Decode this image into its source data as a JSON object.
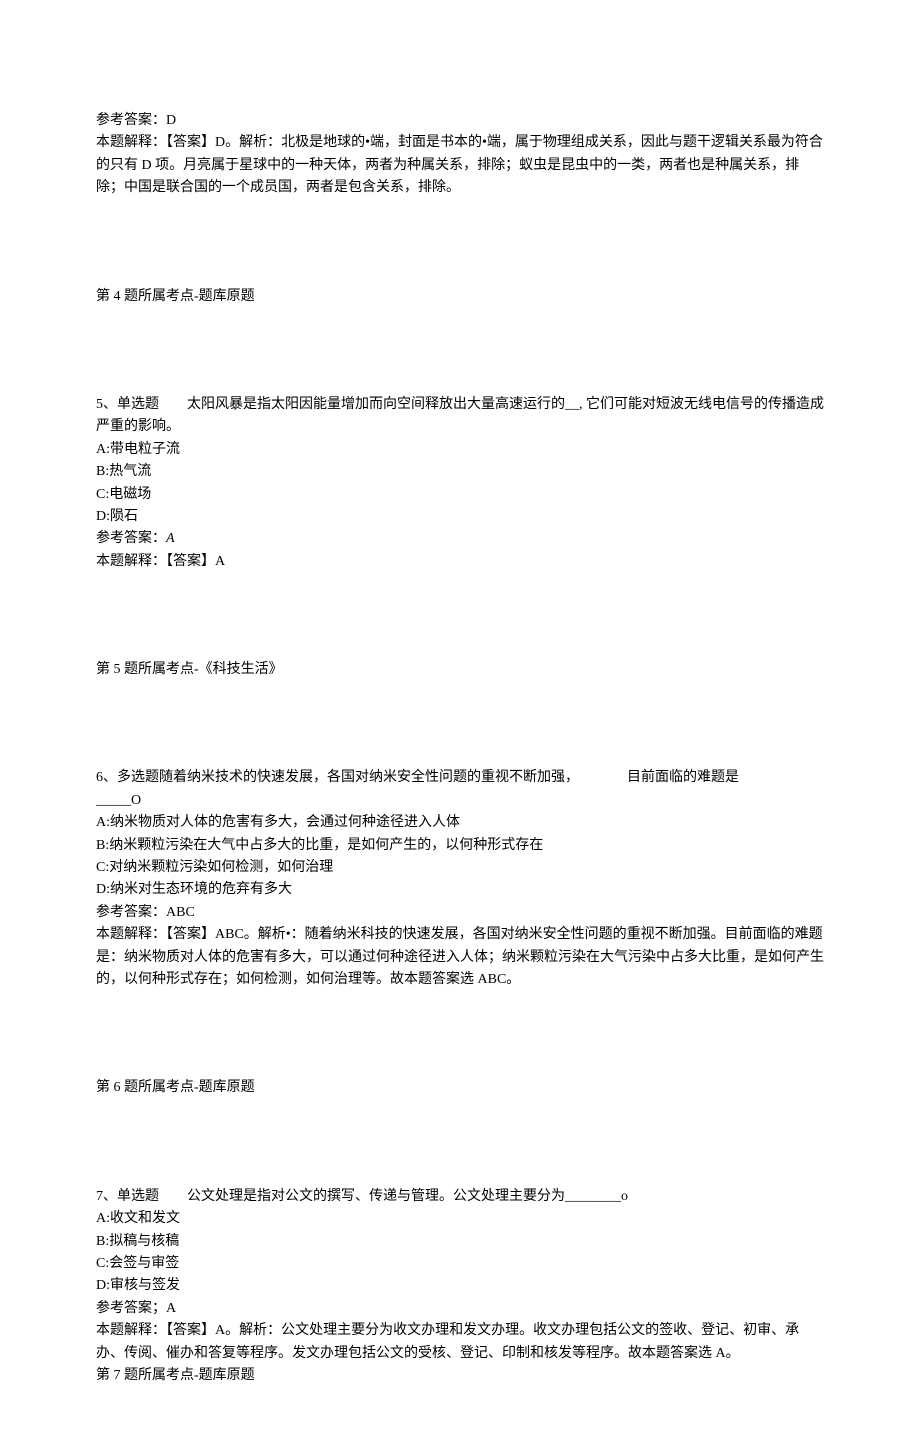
{
  "q4_answer_block": {
    "ref_label": "参考答案：",
    "ref_value": "D",
    "explain": "本题解释：【答案】D。解析：北极是地球的•端，封面是书本的•端，属于物理组成关系，因此与题干逻辑关系最为符合的只有 D 项。月亮属于星球中的一种天体，两者为种属关系，排除；蚁虫是昆虫中的一类，两者也是种属关系，排除；中国是联合国的一个成员国，两者是包含关系，排除。"
  },
  "q4_topic": "第 4 题所属考点-题库原题",
  "q5": {
    "stem_prefix": "5、单选题　　太阳风暴是指太阳因能量增加而向空间释放出大量高速运行的__, 它们可能对短波无线电信号的传播造成严重的影响。",
    "optA": "A:带电粒子流",
    "optB": "B:热气流",
    "optC": "C:电磁场",
    "optD": "D:陨石",
    "ref_label": "参考答案：",
    "ref_value": "A",
    "explain": "本题解释：【答案】A"
  },
  "q5_topic": "第 5 题所属考点-《科技生活》",
  "q6": {
    "stem_line1": "6、多选题随着纳米技术的快速发展，各国对纳米安全性问题的重视不断加强，",
    "stem_line1_tail": "目前面临的难题是",
    "stem_line2": "_____O",
    "optA": "A:纳米物质对人体的危害有多大，会通过何种途径进入人体",
    "optB": "B:纳米颗粒污染在大气中占多大的比重，是如何产生的，以何种形式存在",
    "optC": "C:对纳米颗粒污染如何检测，如何治理",
    "optD": "D:纳米对生态环境的危弃有多大",
    "ref_label": "参考答案：",
    "ref_value": "ABC",
    "explain": "本题解释：【答案】ABC。解析•：随着纳米科技的快速发展，各国对纳米安全性问题的重视不断加强。目前面临的难题是：纳米物质对人体的危害有多大，可以通过何种途径进入人体；纳米颗粒污染在大气污染中占多大比重，是如何产生的，以何种形式存在；如何检测，如何治理等。故本题答案选 ABC。"
  },
  "q6_topic": "第 6 题所属考点-题库原题",
  "q7": {
    "stem": "7、单选题　　公文处理是指对公文的撰写、传递与管理。公文处理主要分为________o",
    "optA": "A:收文和发文",
    "optB": "B:拟稿与核稿",
    "optC": "C:会签与审签",
    "optD": "D:审核与签发",
    "ref_label": "参考答案；",
    "ref_value": "A",
    "explain": "本题解释：【答案】A。解析：公文处理主要分为收文办理和发文办理。收文办理包括公文的签收、登记、初审、承办、传阅、催办和答复等程序。发文办理包括公文的受核、登记、印制和核发等程序。故本题答案选 A。"
  },
  "q7_topic": "第 7 题所属考点-题库原题"
}
